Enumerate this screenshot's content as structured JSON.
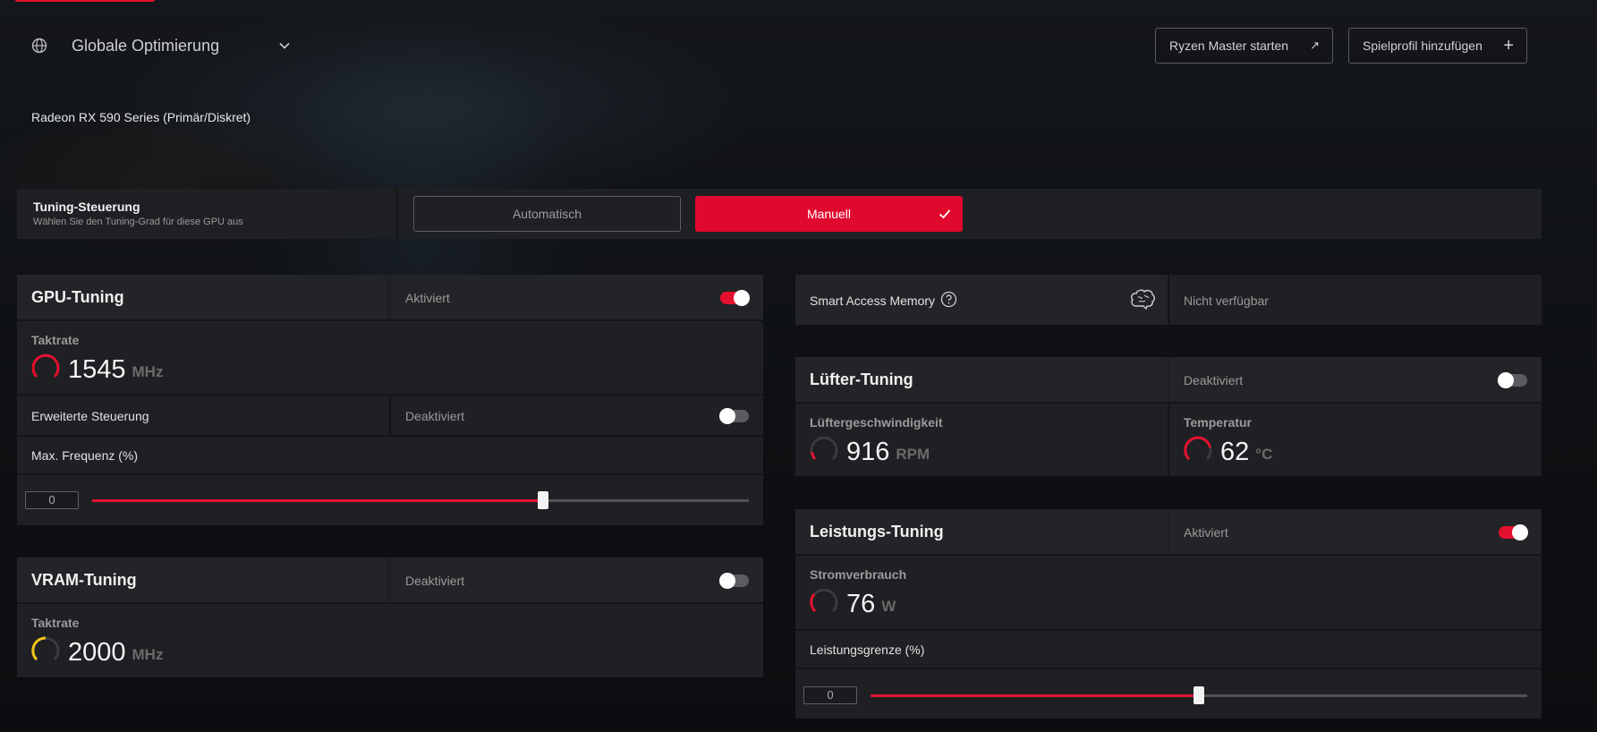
{
  "header": {
    "profile_label": "Globale Optimierung",
    "globe_icon": "globe-icon",
    "chevron_icon": "chevron-down-icon",
    "ryzen_button": "Ryzen Master starten",
    "ryzen_button_icon": "↗",
    "add_profile_button": "Spielprofil hinzufügen",
    "add_profile_icon": "+"
  },
  "device": {
    "name": "Radeon RX 590 Series (Primär/Diskret)"
  },
  "tuning_control": {
    "title": "Tuning-Steuerung",
    "subtitle": "Wählen Sie den Tuning-Grad für diese GPU aus",
    "auto_label": "Automatisch",
    "manual_label": "Manuell",
    "selected": "Manuell"
  },
  "gpu_tuning": {
    "title": "GPU-Tuning",
    "status": "Aktiviert",
    "enabled": true,
    "clock_label": "Taktrate",
    "clock_value": "1545",
    "clock_unit": "MHz",
    "advanced_label": "Erweiterte Steuerung",
    "advanced_status": "Deaktiviert",
    "advanced_enabled": false,
    "max_freq_label": "Max. Frequenz (%)",
    "max_freq_value": "0",
    "slider_fraction": 0.687
  },
  "vram_tuning": {
    "title": "VRAM-Tuning",
    "status": "Deaktiviert",
    "enabled": false,
    "clock_label": "Taktrate",
    "clock_value": "2000",
    "clock_unit": "MHz"
  },
  "smart_access_memory": {
    "label": "Smart Access Memory",
    "status": "Nicht verfügbar"
  },
  "fan_tuning": {
    "title": "Lüfter-Tuning",
    "status": "Deaktiviert",
    "enabled": false,
    "speed_label": "Lüftergeschwindigkeit",
    "speed_value": "916",
    "speed_unit": "RPM",
    "temp_label": "Temperatur",
    "temp_value": "62",
    "temp_unit": "°C"
  },
  "power_tuning": {
    "title": "Leistungs-Tuning",
    "status": "Aktiviert",
    "enabled": true,
    "consumption_label": "Stromverbrauch",
    "consumption_value": "76",
    "consumption_unit": "W",
    "limit_label": "Leistungsgrenze (%)",
    "limit_value": "0",
    "slider_fraction": 0.5
  },
  "colors": {
    "accent": "#e4112e",
    "vram_gauge": "#f0c419",
    "panel": "#1f2023",
    "background": "#0f1114"
  }
}
